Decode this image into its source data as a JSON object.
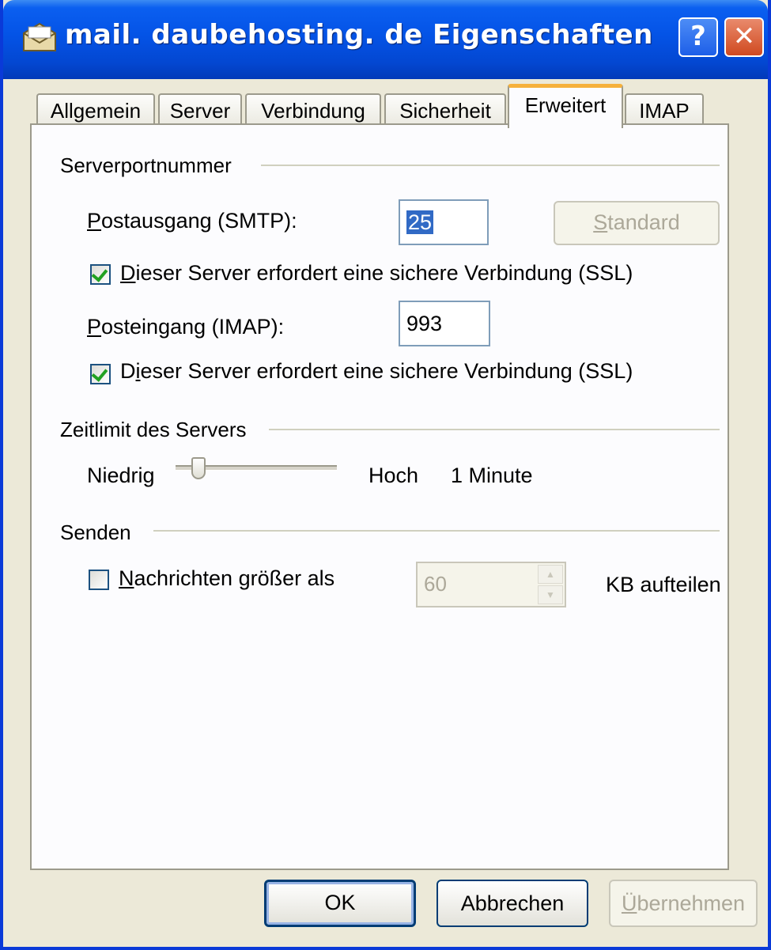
{
  "window": {
    "title": "mail. daubehosting. de Eigenschaften",
    "help_label": "?",
    "close_label": "✕"
  },
  "tabs": [
    {
      "label": "Allgemein"
    },
    {
      "label": "Server"
    },
    {
      "label": "Verbindung"
    },
    {
      "label": "Sicherheit"
    },
    {
      "label": "Erweitert",
      "active": true
    },
    {
      "label": "IMAP"
    }
  ],
  "serverports": {
    "group_label": "Serverportnummer",
    "smtp_label_u": "P",
    "smtp_label_rest": "ostausgang (SMTP):",
    "smtp_value": "25",
    "standard_u": "S",
    "standard_rest": "tandard",
    "smtp_ssl_u": "D",
    "smtp_ssl_rest": "ieser Server erfordert eine sichere Verbindung (SSL)",
    "smtp_ssl_checked": true,
    "imap_label_u": "P",
    "imap_label_rest": "osteingang (IMAP):",
    "imap_value": "993",
    "imap_ssl_pre": "D",
    "imap_ssl_u": "i",
    "imap_ssl_rest": "eser Server erfordert eine sichere Verbindung (SSL)",
    "imap_ssl_checked": true
  },
  "timeout": {
    "group_label": "Zeitlimit des Servers",
    "low_label": "Niedrig",
    "high_label": "Hoch",
    "value_text": "1 Minute",
    "slider_fraction": 0.1
  },
  "send": {
    "group_label": "Senden",
    "split_u": "N",
    "split_rest": "achrichten größer als",
    "split_checked": false,
    "split_value": "60",
    "unit_label": "KB aufteilen"
  },
  "buttons": {
    "ok": "OK",
    "cancel": "Abbrechen",
    "apply_u": "Ü",
    "apply_rest": "bernehmen"
  }
}
